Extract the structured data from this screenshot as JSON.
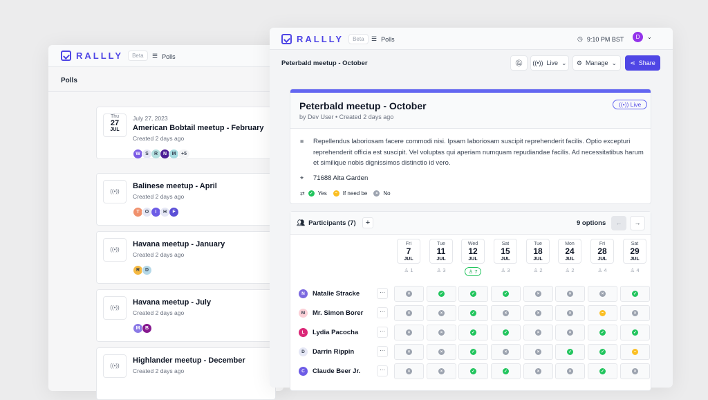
{
  "colors": {
    "brand": "#4f46e5",
    "yes": "#22c55e",
    "ifneedbe": "#fbbf24",
    "no": "#9ca3af"
  },
  "back": {
    "logo": "RALLLY",
    "beta": "Beta",
    "nav_polls": "Polls",
    "page_title": "Polls",
    "polls": [
      {
        "date_label": "July 27, 2023",
        "dow": "Thu",
        "day": "27",
        "month": "JUL",
        "title": "American Bobtail meetup - February",
        "created": "Created 2 days ago",
        "avatars": [
          [
            "W",
            "#7c5ce6"
          ],
          [
            "S",
            "#e5e7f5"
          ],
          [
            "R",
            "#b4e0e0"
          ],
          [
            "N",
            "#4c1d95"
          ],
          [
            "M",
            "#a5dbe0"
          ]
        ],
        "more": "+5"
      },
      {
        "title": "Balinese meetup - April",
        "created": "Created 2 days ago",
        "avatars": [
          [
            "T",
            "#f0916d"
          ],
          [
            "O",
            "#e5e7f5"
          ],
          [
            "I",
            "#6d5ce6"
          ],
          [
            "H",
            "#e5e7f5"
          ],
          [
            "F",
            "#5b4fd6"
          ]
        ]
      },
      {
        "title": "Havana meetup - January",
        "created": "Created 2 days ago",
        "avatars": [
          [
            "R",
            "#f5b942"
          ],
          [
            "D",
            "#b4d8e8"
          ]
        ]
      },
      {
        "title": "Havana meetup - July",
        "created": "Created 2 days ago",
        "avatars": [
          [
            "M",
            "#8b7ae6"
          ],
          [
            "B",
            "#86198f"
          ]
        ]
      },
      {
        "title": "Highlander meetup - December",
        "created": "Created 2 days ago",
        "avatars": []
      }
    ]
  },
  "front": {
    "logo": "RALLLY",
    "beta": "Beta",
    "nav_polls": "Polls",
    "time": "9:10 PM BST",
    "user_initial": "D",
    "toolbar": {
      "title": "Peterbald meetup - October",
      "live": "Live",
      "manage": "Manage",
      "share": "Share"
    },
    "poll": {
      "title": "Peterbald meetup - October",
      "byline": "by Dev User",
      "created": "Created 2 days ago",
      "badge": "Live",
      "description": "Repellendus laboriosam facere commodi nisi. Ipsam laboriosam suscipit reprehenderit facilis. Optio excepturi reprehenderit officia est suscipit. Vel voluptas qui aperiam numquam repudiandae facilis. Ad necessitatibus harum et similique nobis dignissimos distinctio id vero.",
      "location": "71688 Alta Garden",
      "legend": {
        "yes": "Yes",
        "ifneedbe": "If need be",
        "no": "No"
      }
    },
    "participants": {
      "label": "Participants (7)",
      "options_count": "9 options",
      "dates": [
        {
          "dow": "Fri",
          "day": "7",
          "month": "JUL",
          "count": "1"
        },
        {
          "dow": "Tue",
          "day": "11",
          "month": "JUL",
          "count": "3"
        },
        {
          "dow": "Wed",
          "day": "12",
          "month": "JUL",
          "count": "7",
          "highlight": true
        },
        {
          "dow": "Sat",
          "day": "15",
          "month": "JUL",
          "count": "3"
        },
        {
          "dow": "Tue",
          "day": "18",
          "month": "JUL",
          "count": "2"
        },
        {
          "dow": "Mon",
          "day": "24",
          "month": "JUL",
          "count": "2"
        },
        {
          "dow": "Fri",
          "day": "28",
          "month": "JUL",
          "count": "4"
        },
        {
          "dow": "Sat",
          "day": "29",
          "month": "JUL",
          "count": "4"
        }
      ],
      "rows": [
        {
          "initial": "N",
          "name": "Natalie Stracke",
          "color": "#7c6ae0",
          "votes": [
            "no",
            "yes",
            "yes",
            "yes",
            "no",
            "no",
            "no",
            "yes"
          ]
        },
        {
          "initial": "M",
          "name": "Mr. Simon Borer",
          "color": "#fbcfd6",
          "votes": [
            "no",
            "no",
            "yes",
            "no",
            "no",
            "no",
            "ifneedbe",
            "no"
          ]
        },
        {
          "initial": "L",
          "name": "Lydia Pacocha",
          "color": "#db2777",
          "votes": [
            "no",
            "no",
            "yes",
            "yes",
            "no",
            "no",
            "yes",
            "yes"
          ]
        },
        {
          "initial": "D",
          "name": "Darrin Rippin",
          "color": "#e5e7f5",
          "votes": [
            "no",
            "no",
            "yes",
            "no",
            "no",
            "yes",
            "yes",
            "ifneedbe"
          ]
        },
        {
          "initial": "C",
          "name": "Claude Beer Jr.",
          "color": "#6d5ce6",
          "votes": [
            "no",
            "no",
            "yes",
            "yes",
            "no",
            "no",
            "yes",
            "no"
          ]
        }
      ]
    }
  }
}
